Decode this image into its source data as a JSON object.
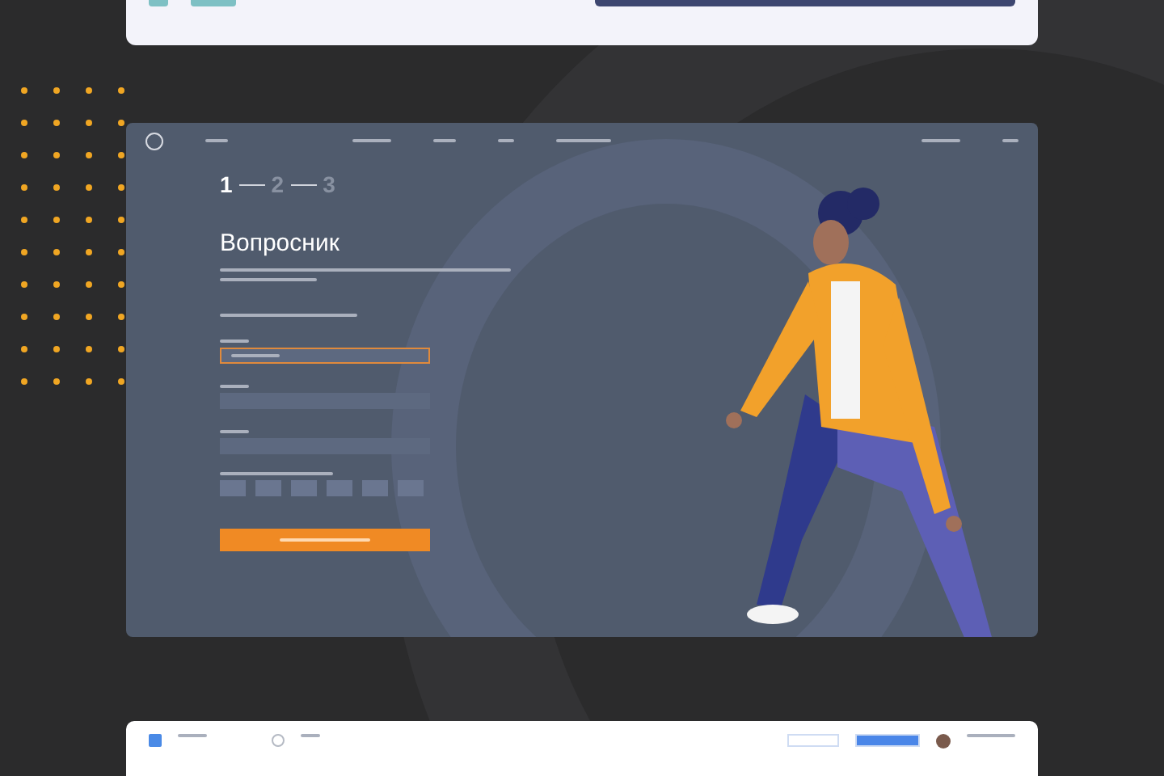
{
  "steps": [
    {
      "label": "1",
      "active": true
    },
    {
      "label": "2",
      "active": false
    },
    {
      "label": "3",
      "active": false
    }
  ],
  "heading": "Вопросник",
  "fields": [
    {
      "focused": true
    },
    {
      "focused": false
    },
    {
      "focused": false
    }
  ]
}
